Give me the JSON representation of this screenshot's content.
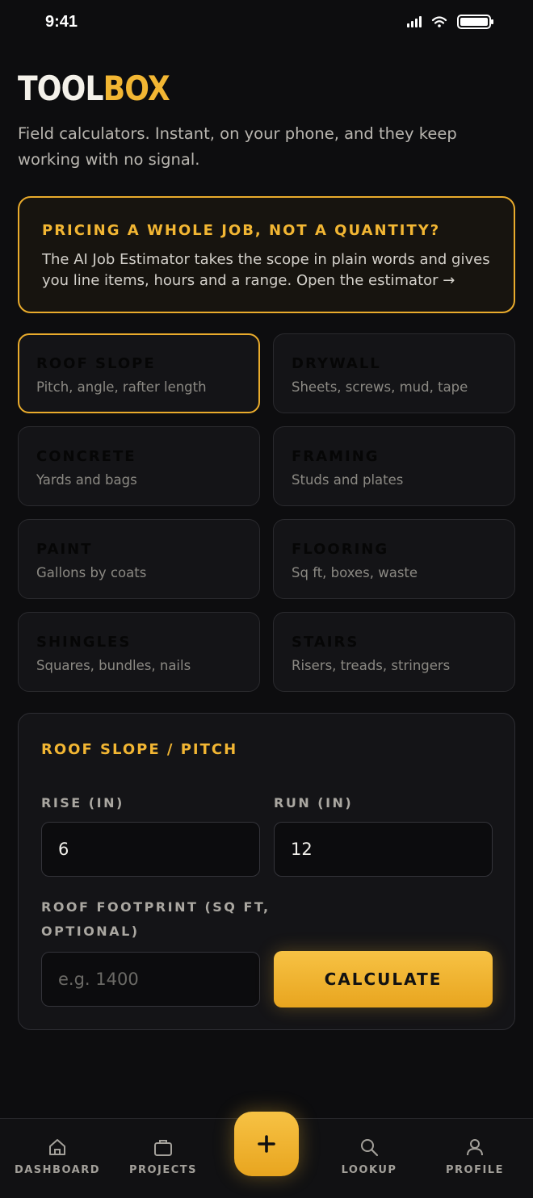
{
  "status": {
    "time": "9:41",
    "signal_icon": "signal-icon",
    "wifi_icon": "wifi-icon",
    "battery_icon": "battery-icon"
  },
  "header": {
    "logo_part1": "TOOL",
    "logo_part2": "BOX",
    "intro": "Field calculators. Instant, on your phone, and they keep working with no signal."
  },
  "promo": {
    "title": "PRICING A WHOLE JOB, NOT A QUANTITY?",
    "body": "The AI Job Estimator takes the scope in plain words and gives you line items, hours and a range. Open the estimator →"
  },
  "tools": [
    {
      "name": "ROOF SLOPE",
      "desc": "Pitch, angle, rafter length",
      "selected": true
    },
    {
      "name": "DRYWALL",
      "desc": "Sheets, screws, mud, tape"
    },
    {
      "name": "CONCRETE",
      "desc": "Yards and bags"
    },
    {
      "name": "FRAMING",
      "desc": "Studs and plates"
    },
    {
      "name": "PAINT",
      "desc": "Gallons by coats"
    },
    {
      "name": "FLOORING",
      "desc": "Sq ft, boxes, waste"
    },
    {
      "name": "SHINGLES",
      "desc": "Squares, bundles, nails"
    },
    {
      "name": "STAIRS",
      "desc": "Risers, treads, stringers"
    }
  ],
  "calculator": {
    "title": "ROOF SLOPE / PITCH",
    "rise_label": "RISE (IN)",
    "rise_value": "6",
    "run_label": "RUN (IN)",
    "run_value": "12",
    "footprint_label_line1": "ROOF FOOTPRINT (SQ FT,",
    "footprint_label_line2": "OPTIONAL)",
    "footprint_placeholder": "e.g. 1400",
    "footprint_value": "",
    "button_label": "CALCULATE"
  },
  "tabbar": {
    "tabs": [
      {
        "label": "DASHBOARD",
        "icon": "home-icon"
      },
      {
        "label": "PROJECTS",
        "icon": "briefcase-icon"
      },
      {
        "label": "LOOKUP",
        "icon": "search-icon"
      },
      {
        "label": "PROFILE",
        "icon": "user-icon"
      }
    ],
    "fab_icon": "plus-icon"
  },
  "colors": {
    "accent": "#f2b633",
    "background": "#0d0d0f",
    "card": "#141417"
  }
}
